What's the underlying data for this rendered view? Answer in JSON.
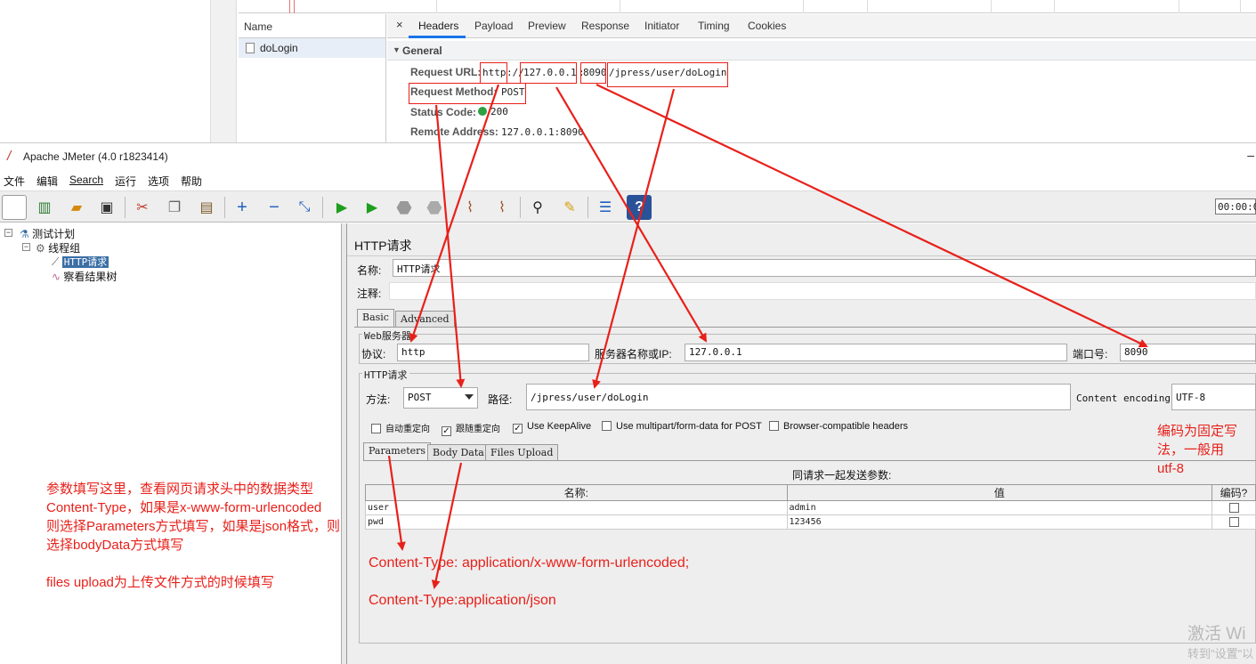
{
  "devtools": {
    "name_header": "Name",
    "request_name": "doLogin",
    "tabs": [
      "×",
      "Headers",
      "Payload",
      "Preview",
      "Response",
      "Initiator",
      "Timing",
      "Cookies"
    ],
    "section": "General",
    "fields": [
      {
        "label": "Request URL:",
        "value": "http://127.0.0.1:8090/jpress/user/doLogin"
      },
      {
        "label": "Request Method:",
        "value": "POST"
      },
      {
        "label": "Status Code:",
        "value": "200"
      },
      {
        "label": "Remote Address:",
        "value": "127.0.0.1:8090"
      }
    ],
    "url_parts": {
      "scheme": "http",
      "sep1": "://",
      "host": "127.0.0.1",
      "sep2": ":",
      "port": "8090",
      "path": "/jpress/user/doLogin"
    }
  },
  "jmeter": {
    "title": "Apache JMeter (4.0 r1823414)",
    "menu": [
      "文件",
      "编辑",
      "Search",
      "运行",
      "选项",
      "帮助"
    ],
    "timer": "00:00:0",
    "tree": {
      "plan": "测试计划",
      "thread_group": "线程组",
      "http_request": "HTTP请求",
      "result_tree": "察看结果树"
    },
    "panel": {
      "title": "HTTP请求",
      "name_label": "名称:",
      "name_value": "HTTP请求",
      "comment_label": "注释:",
      "tabs_top": [
        "Basic",
        "Advanced"
      ],
      "web_server_legend": "Web服务器",
      "protocol_label": "协议:",
      "protocol_value": "http",
      "server_label": "服务器名称或IP:",
      "server_value": "127.0.0.1",
      "port_label": "端口号:",
      "port_value": "8090",
      "http_legend": "HTTP请求",
      "method_label": "方法:",
      "method_value": "POST",
      "path_label": "路径:",
      "path_value": "/jpress/user/doLogin",
      "encoding_label": "Content encoding:",
      "encoding_value": "UTF-8",
      "checkboxes": [
        {
          "label": "自动重定向",
          "checked": false
        },
        {
          "label": "跟随重定向",
          "checked": true
        },
        {
          "label": "Use KeepAlive",
          "checked": true
        },
        {
          "label": "Use multipart/form-data for POST",
          "checked": false
        },
        {
          "label": "Browser-compatible headers",
          "checked": false
        }
      ],
      "tabs_bottom": [
        "Parameters",
        "Body Data",
        "Files Upload"
      ],
      "params_caption": "同请求一起发送参数:",
      "params_columns": [
        "名称:",
        "值",
        "编码?"
      ],
      "params_rows": [
        {
          "name": "user",
          "value": "admin"
        },
        {
          "name": "pwd",
          "value": "123456"
        }
      ]
    }
  },
  "annotations": {
    "left_note": [
      "参数填写这里，查看网页请求头中的数据类型",
      "Content-Type，如果是x-www-form-urlencoded",
      "则选择Parameters方式填写，如果是json格式，则",
      "选择bodyData方式填写",
      "",
      "files upload为上传文件方式的时候填写"
    ],
    "right_note": [
      "编码为固定写",
      "法，一般用",
      "utf-8"
    ],
    "ct_form": "Content-Type: application/x-www-form-urlencoded;",
    "ct_json": "Content-Type:application/json",
    "annotation_color": "#e8201a"
  },
  "watermark": {
    "line1": "激活 Wi",
    "line2": "转到\"设置\"以"
  }
}
